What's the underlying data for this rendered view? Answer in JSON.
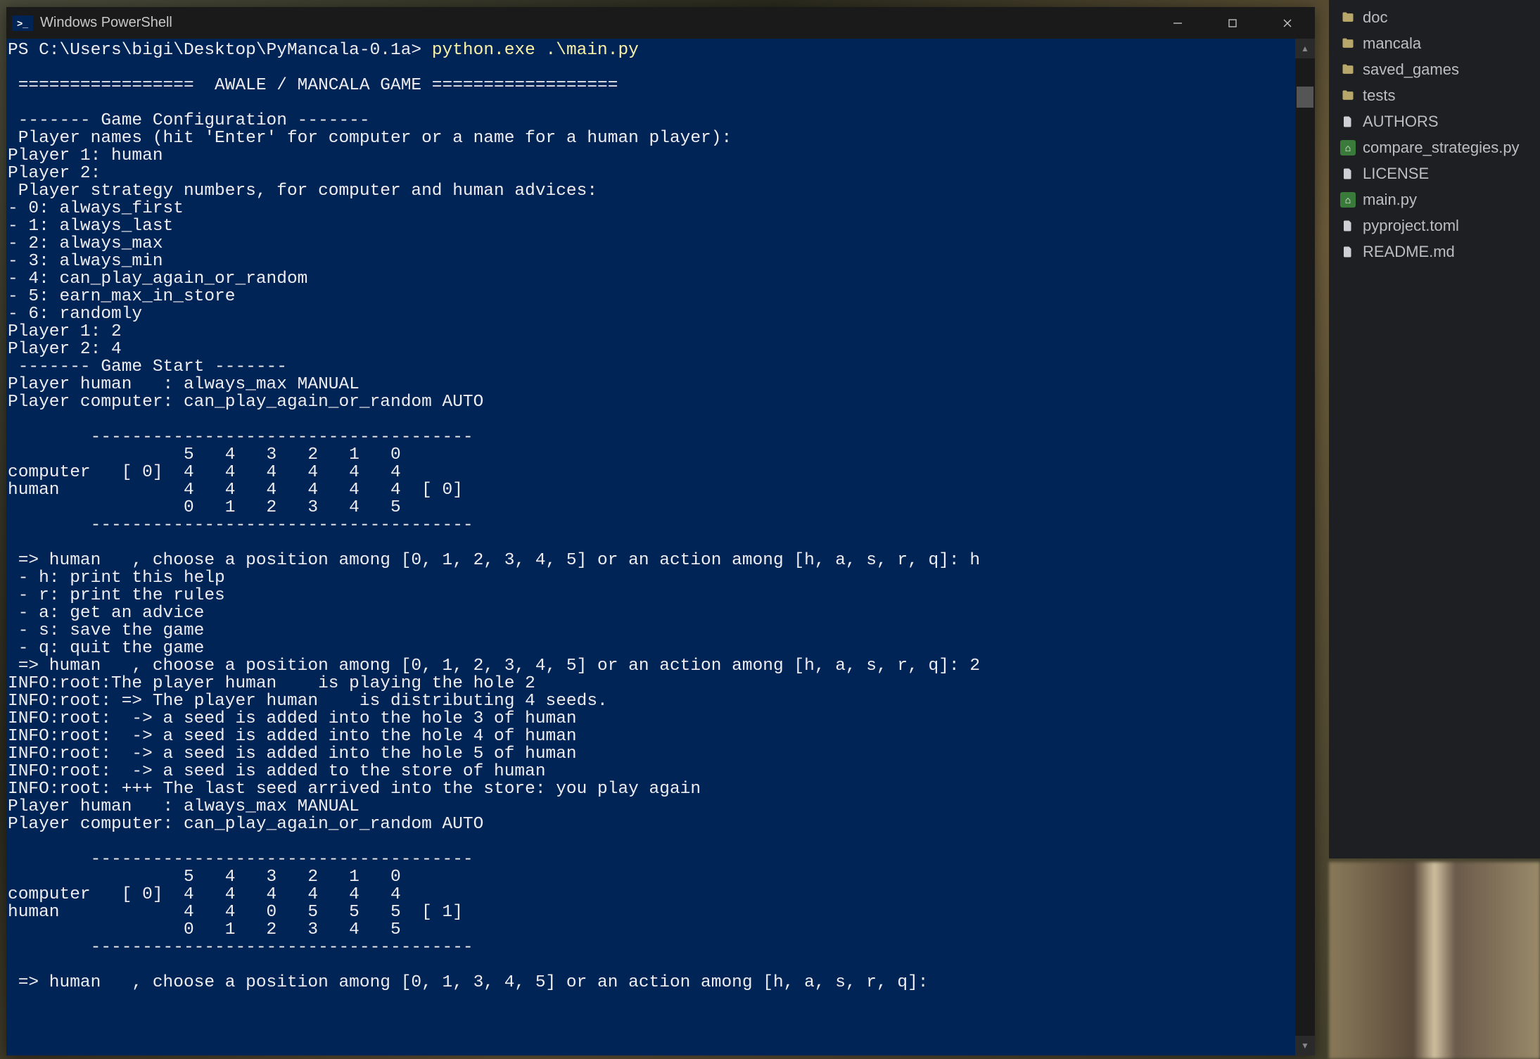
{
  "window": {
    "title": "Windows PowerShell"
  },
  "prompt": {
    "path": "PS C:\\Users\\bigi\\Desktop\\PyMancala-0.1a> ",
    "command": "python.exe .\\main.py"
  },
  "lines": [
    "",
    " =================  AWALE / MANCALA GAME ==================",
    "",
    " ------- Game Configuration -------",
    " Player names (hit 'Enter' for computer or a name for a human player):",
    "Player 1: human",
    "Player 2:",
    " Player strategy numbers, for computer and human advices:",
    "- 0: always_first",
    "- 1: always_last",
    "- 2: always_max",
    "- 3: always_min",
    "- 4: can_play_again_or_random",
    "- 5: earn_max_in_store",
    "- 6: randomly",
    "Player 1: 2",
    "Player 2: 4",
    " ------- Game Start -------",
    "Player human   : always_max MANUAL",
    "Player computer: can_play_again_or_random AUTO",
    "",
    "        -------------------------------------",
    "                 5   4   3   2   1   0",
    "computer   [ 0]  4   4   4   4   4   4",
    "human            4   4   4   4   4   4  [ 0]",
    "                 0   1   2   3   4   5",
    "        -------------------------------------",
    "",
    " => human   , choose a position among [0, 1, 2, 3, 4, 5] or an action among [h, a, s, r, q]: h",
    " - h: print this help",
    " - r: print the rules",
    " - a: get an advice",
    " - s: save the game",
    " - q: quit the game",
    " => human   , choose a position among [0, 1, 2, 3, 4, 5] or an action among [h, a, s, r, q]: 2",
    "INFO:root:The player human    is playing the hole 2",
    "INFO:root: => The player human    is distributing 4 seeds.",
    "INFO:root:  -> a seed is added into the hole 3 of human",
    "INFO:root:  -> a seed is added into the hole 4 of human",
    "INFO:root:  -> a seed is added into the hole 5 of human",
    "INFO:root:  -> a seed is added to the store of human",
    "INFO:root: +++ The last seed arrived into the store: you play again",
    "Player human   : always_max MANUAL",
    "Player computer: can_play_again_or_random AUTO",
    "",
    "        -------------------------------------",
    "                 5   4   3   2   1   0",
    "computer   [ 0]  4   4   4   4   4   4",
    "human            4   4   0   5   5   5  [ 1]",
    "                 0   1   2   3   4   5",
    "        -------------------------------------",
    "",
    " => human   , choose a position among [0, 1, 3, 4, 5] or an action among [h, a, s, r, q]:",
    ""
  ],
  "files": [
    {
      "type": "folder",
      "name": "doc"
    },
    {
      "type": "folder",
      "name": "mancala"
    },
    {
      "type": "folder",
      "name": "saved_games"
    },
    {
      "type": "folder",
      "name": "tests"
    },
    {
      "type": "file",
      "name": "AUTHORS"
    },
    {
      "type": "py",
      "name": "compare_strategies.py"
    },
    {
      "type": "file",
      "name": "LICENSE"
    },
    {
      "type": "py",
      "name": "main.py"
    },
    {
      "type": "file",
      "name": "pyproject.toml"
    },
    {
      "type": "file",
      "name": "README.md"
    }
  ]
}
